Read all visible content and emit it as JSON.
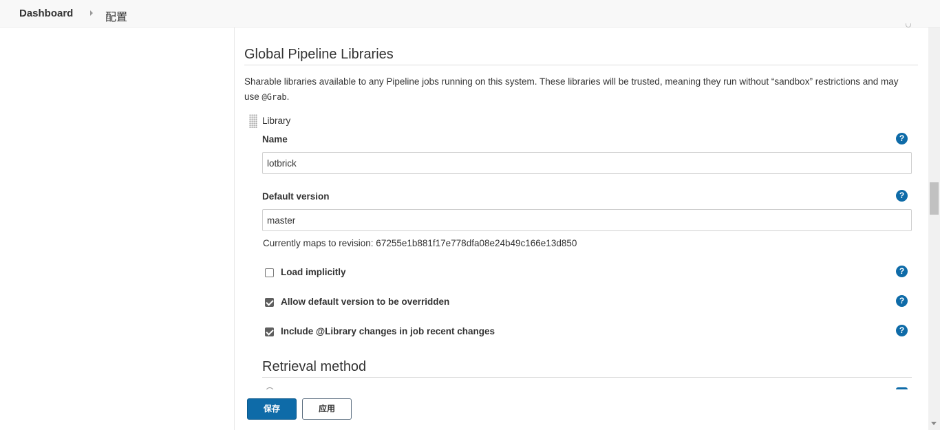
{
  "breadcrumb": {
    "home": "Dashboard",
    "current": "配置"
  },
  "section": {
    "title": "Global Pipeline Libraries",
    "description_before": "Sharable libraries available to any Pipeline jobs running on this system. These libraries will be trusted, meaning they run without “sandbox” restrictions and may use ",
    "description_code": "@Grab",
    "description_after": "."
  },
  "library": {
    "heading": "Library",
    "name_label": "Name",
    "name_value": "lotbrick",
    "default_version_label": "Default version",
    "default_version_value": "master",
    "revision_text": "Currently maps to revision: 67255e1b881f17e778dfa08e24b49c166e13d850",
    "options": [
      {
        "label": "Load implicitly",
        "checked": false
      },
      {
        "label": "Allow default version to be overridden",
        "checked": true
      },
      {
        "label": "Include @Library changes in job recent changes",
        "checked": true
      }
    ],
    "retrieval_title": "Retrieval method"
  },
  "help_icon_glyph": "?",
  "buttons": {
    "save": "保存",
    "apply": "应用"
  },
  "colors": {
    "primary": "#0e6ba8",
    "topbar_bg": "#f8f8f8"
  }
}
